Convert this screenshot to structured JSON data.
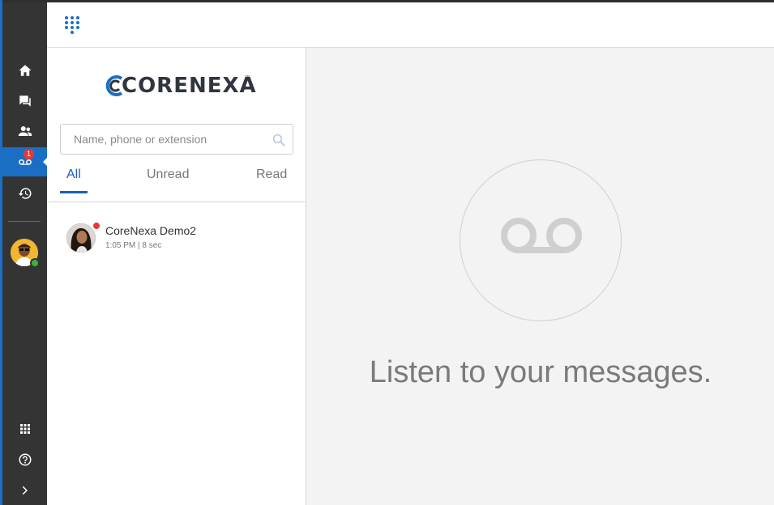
{
  "brand": {
    "logo_text": "CORENEXA",
    "trademark": "™"
  },
  "rail": {
    "items": [
      {
        "name": "home",
        "icon": "home-icon"
      },
      {
        "name": "chat",
        "icon": "chat-icon"
      },
      {
        "name": "contacts",
        "icon": "contacts-icon"
      },
      {
        "name": "voicemail",
        "icon": "voicemail-icon",
        "badge": "1",
        "active": true
      },
      {
        "name": "history",
        "icon": "history-icon"
      },
      {
        "name": "apps",
        "icon": "apps-grid-icon"
      },
      {
        "name": "help",
        "icon": "help-icon"
      },
      {
        "name": "expand",
        "icon": "chevron-right-icon"
      }
    ]
  },
  "search": {
    "placeholder": "Name, phone or extension"
  },
  "tabs": [
    {
      "label": "All",
      "active": true
    },
    {
      "label": "Unread",
      "active": false
    },
    {
      "label": "Read",
      "active": false
    }
  ],
  "voicemails": [
    {
      "name": "CoreNexa Demo2",
      "meta": "1:05 PM | 8 sec",
      "unread": true
    }
  ],
  "empty_state": {
    "message": "Listen to your messages.",
    "icon": "voicemail-icon"
  },
  "colors": {
    "accent": "#1a6fc4",
    "rail": "#343434",
    "badge": "#e53935",
    "online": "#3cb043"
  }
}
